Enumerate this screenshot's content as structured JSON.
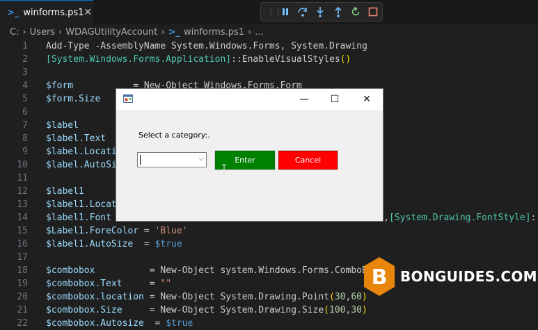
{
  "tab": {
    "icon": "powershell-icon",
    "label": "winforms.ps1",
    "close": "✕"
  },
  "debug_toolbar": {
    "buttons": [
      "pause-icon",
      "step-over-icon",
      "step-into-icon",
      "step-out-icon",
      "restart-icon",
      "stop-icon"
    ]
  },
  "breadcrumb": {
    "parts": [
      "C:",
      "Users",
      "WDAGUtilityAccount"
    ],
    "file": "winforms.ps1",
    "trailing": "..."
  },
  "code_lines": [
    {
      "n": "1",
      "segs": [
        [
          "w",
          "Add-Type -AssemblyName System.Windows.Forms, System.Drawing"
        ]
      ]
    },
    {
      "n": "2",
      "segs": [
        [
          "t",
          "[System.Windows.Forms.Application]"
        ],
        [
          "w",
          "::EnableVisualStyles"
        ],
        [
          "y",
          "()"
        ]
      ]
    },
    {
      "n": "3",
      "segs": []
    },
    {
      "n": "4",
      "segs": [
        [
          "v",
          "$form"
        ],
        [
          "w",
          "           = New-Object Windows.Forms.Form"
        ]
      ]
    },
    {
      "n": "5",
      "segs": [
        [
          "v",
          "$form.Size"
        ]
      ]
    },
    {
      "n": "6",
      "segs": []
    },
    {
      "n": "7",
      "segs": [
        [
          "v",
          "$label"
        ]
      ]
    },
    {
      "n": "8",
      "segs": [
        [
          "v",
          "$label.Text"
        ]
      ]
    },
    {
      "n": "9",
      "segs": [
        [
          "v",
          "$label.Locati"
        ]
      ]
    },
    {
      "n": "10",
      "segs": [
        [
          "v",
          "$label.AutoSi"
        ]
      ]
    },
    {
      "n": "11",
      "segs": []
    },
    {
      "n": "12",
      "segs": [
        [
          "v",
          "$label1"
        ]
      ]
    },
    {
      "n": "13",
      "segs": [
        [
          "v",
          "$label1.Locat"
        ]
      ]
    },
    {
      "n": "14",
      "segs": [
        [
          "v",
          "$label1.Font"
        ],
        [
          "w",
          "                                                 1,"
        ],
        [
          "t",
          "[System.Drawing.FontStyle]"
        ],
        [
          "w",
          ":"
        ]
      ]
    },
    {
      "n": "15",
      "segs": [
        [
          "v",
          "$Label1.ForeColor"
        ],
        [
          "w",
          " = "
        ],
        [
          "s",
          "'Blue'"
        ]
      ]
    },
    {
      "n": "16",
      "segs": [
        [
          "v",
          "$label1.AutoSize"
        ],
        [
          "w",
          "  = "
        ],
        [
          "k",
          "$true"
        ]
      ]
    },
    {
      "n": "17",
      "segs": []
    },
    {
      "n": "18",
      "segs": [
        [
          "v",
          "$combobox"
        ],
        [
          "w",
          "          = New-Object system.Windows.Forms.ComboBox"
        ]
      ]
    },
    {
      "n": "19",
      "segs": [
        [
          "v",
          "$combobox.Text"
        ],
        [
          "w",
          "     = "
        ],
        [
          "s",
          "\"\""
        ]
      ]
    },
    {
      "n": "20",
      "segs": [
        [
          "v",
          "$combobox.location"
        ],
        [
          "w",
          " = New-Object System.Drawing.Point"
        ],
        [
          "y",
          "("
        ],
        [
          "n",
          "30"
        ],
        [
          "w",
          ","
        ],
        [
          "n",
          "60"
        ],
        [
          "y",
          ")"
        ]
      ]
    },
    {
      "n": "21",
      "segs": [
        [
          "v",
          "$combobox.Size"
        ],
        [
          "w",
          "     = New-Object System.Drawing.Size"
        ],
        [
          "y",
          "("
        ],
        [
          "n",
          "100"
        ],
        [
          "w",
          ","
        ],
        [
          "n",
          "30"
        ],
        [
          "y",
          ")"
        ]
      ]
    },
    {
      "n": "22",
      "segs": [
        [
          "v",
          "$combobox.Autosize"
        ],
        [
          "w",
          "  = "
        ],
        [
          "k",
          "$true"
        ]
      ]
    }
  ],
  "dialog": {
    "minimize": "—",
    "maximize": "☐",
    "close": "✕",
    "label": "Select a category:.",
    "combo_value": "",
    "enter_label": "Enter",
    "cancel_label": "Cancel",
    "colors": {
      "enter": "#008000",
      "cancel": "#ff0000"
    }
  },
  "watermark": {
    "text": "BONGUIDES.COM",
    "letter": "B",
    "color": "#e8860c"
  }
}
